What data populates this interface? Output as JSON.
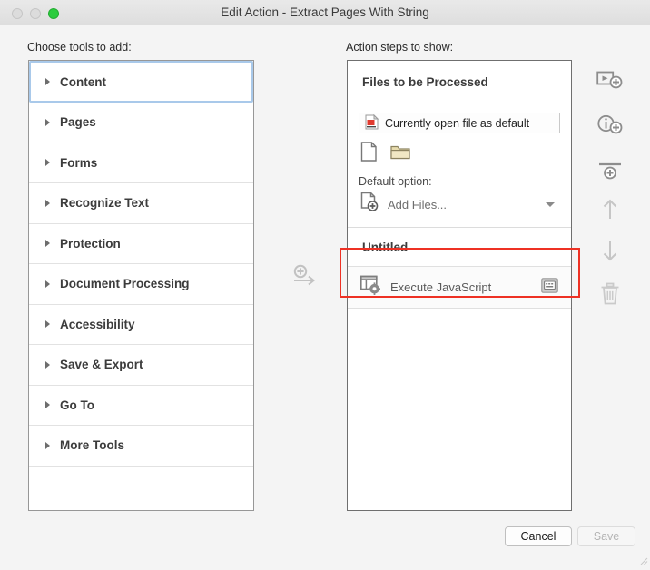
{
  "window": {
    "title": "Edit Action - Extract Pages With String",
    "traffic_lights": [
      {
        "name": "close-button",
        "color": "#dcdcdc",
        "enabled": false
      },
      {
        "name": "minimize-button",
        "color": "#dcdcdc",
        "enabled": false
      },
      {
        "name": "zoom-button",
        "color": "#2bcc3e",
        "enabled": true
      }
    ]
  },
  "left": {
    "label": "Choose tools to add:",
    "items": [
      {
        "label": "Content",
        "selected": true
      },
      {
        "label": "Pages",
        "selected": false
      },
      {
        "label": "Forms",
        "selected": false
      },
      {
        "label": "Recognize Text",
        "selected": false
      },
      {
        "label": "Protection",
        "selected": false
      },
      {
        "label": "Document Processing",
        "selected": false
      },
      {
        "label": "Accessibility",
        "selected": false
      },
      {
        "label": "Save & Export",
        "selected": false
      },
      {
        "label": "Go To",
        "selected": false
      },
      {
        "label": "More Tools",
        "selected": false
      }
    ]
  },
  "middle": {
    "add_arrow_icon": "add-arrow-right-icon"
  },
  "right": {
    "label": "Action steps to show:",
    "files_section": {
      "header": "Files to be Processed",
      "file_chip": {
        "icon": "pdf-file-icon",
        "text": "Currently open file as default"
      },
      "icons": [
        {
          "name": "document-icon"
        },
        {
          "name": "folder-icon"
        }
      ],
      "default_option_label": "Default option:",
      "dropdown": {
        "icon": "add-files-icon",
        "value": "Add Files...",
        "caret": "chevron-down-icon"
      }
    },
    "steps_section": {
      "header": "Untitled",
      "steps": [
        {
          "icon": "execute-javascript-icon",
          "label": "Execute JavaScript",
          "options_icon": "step-options-icon",
          "highlighted": true
        }
      ]
    }
  },
  "toolbar": {
    "buttons": [
      {
        "name": "add-step-icon",
        "enabled": true
      },
      {
        "name": "add-instruction-icon",
        "enabled": true
      },
      {
        "name": "add-divider-icon",
        "enabled": true
      },
      {
        "name": "move-up-icon",
        "enabled": false
      },
      {
        "name": "move-down-icon",
        "enabled": false
      },
      {
        "name": "delete-icon",
        "enabled": false
      }
    ]
  },
  "footer": {
    "cancel_label": "Cancel",
    "save_label": "Save",
    "save_enabled": false
  },
  "colors": {
    "highlight_red": "#ee3124",
    "selection_blue": "#a9c9ea",
    "window_bg": "#f4f4f4"
  }
}
